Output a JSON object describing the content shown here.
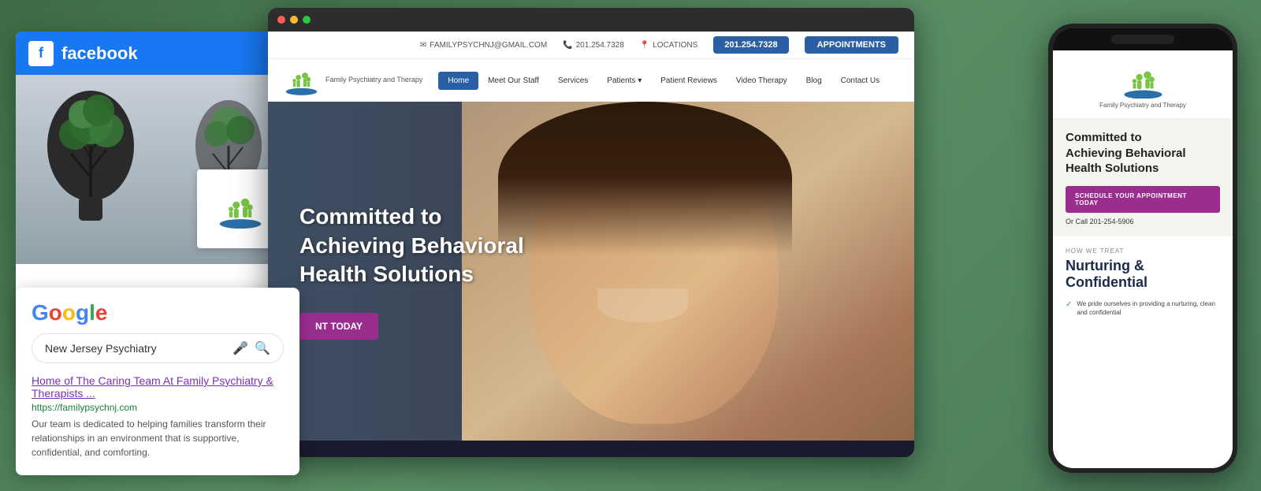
{
  "background": {
    "color": "#4a7c59"
  },
  "facebook_card": {
    "logo_letter": "f",
    "title": "facebook"
  },
  "google_card": {
    "logo": "Google",
    "search_placeholder": "New Jersey Psychiatry",
    "search_text": "New Jersey Psychiatry",
    "result_title": "Home of The Caring Team At Family Psychiatry & Therapists ...",
    "result_url": "https://familypsychnj.com",
    "result_desc": "Our team is dedicated to helping families transform their relationships in an environment that is supportive, confidential, and comforting."
  },
  "website": {
    "topbar": {
      "email": "FAMILYPSYCHNJ@GMAIL.COM",
      "phone": "201.254.7328",
      "locations": "LOCATIONS",
      "phone_btn": "201.254.7328",
      "appt_btn": "APPOINTMENTS"
    },
    "logo_text": "Family Psychiatry and Therapy",
    "nav": {
      "items": [
        {
          "label": "Home",
          "active": true
        },
        {
          "label": "Meet Our Staff",
          "active": false
        },
        {
          "label": "Services",
          "active": false
        },
        {
          "label": "Patients",
          "active": false,
          "has_dropdown": true
        },
        {
          "label": "Patient Reviews",
          "active": false
        },
        {
          "label": "Video Therapy",
          "active": false
        },
        {
          "label": "Blog",
          "active": false
        },
        {
          "label": "Contact Us",
          "active": false
        }
      ]
    },
    "hero": {
      "heading": "Committed to\nAchieving Behavioral\nHealth Solutions",
      "cta_label": "NT TODAY"
    }
  },
  "phone": {
    "logo_text": "Family Psychiatry and Therapy",
    "hero_heading": "Committed to\nAchieving Behavioral\nHealth Solutions",
    "schedule_btn": "SCHEDULE YOUR APPOINTMENT TODAY",
    "call_text": "Or Call 201-254-5906",
    "how_treat": "HOW WE TREAT",
    "nurturing": "Nurturing &\nConfidential",
    "check_item": "We pride ourselves in providing a nurturing, clean and confidential"
  }
}
